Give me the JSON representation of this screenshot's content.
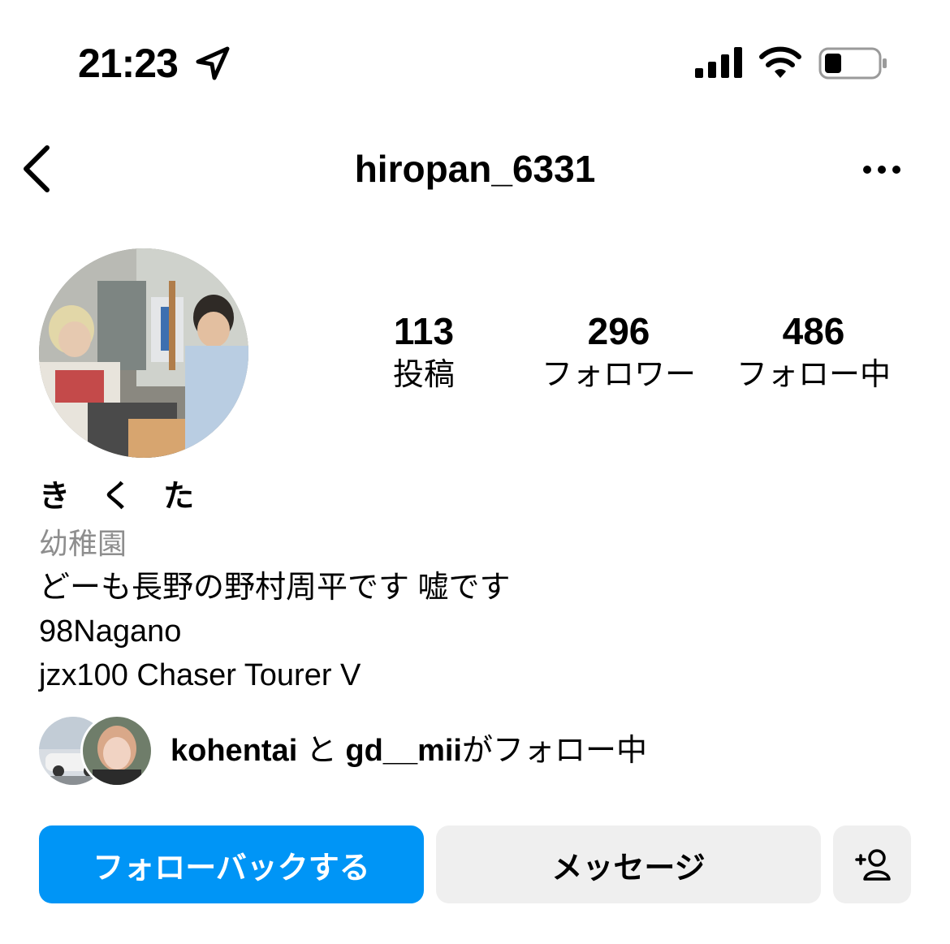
{
  "status_bar": {
    "time": "21:23",
    "icons": [
      "location-arrow-icon",
      "cellular-signal-icon",
      "wifi-icon",
      "battery-icon"
    ]
  },
  "header": {
    "username": "hiropan_6331",
    "back_icon": "chevron-left-icon",
    "more_icon": "ellipsis-icon"
  },
  "profile": {
    "stats": [
      {
        "value": "113",
        "label": "投稿"
      },
      {
        "value": "296",
        "label": "フォロワー"
      },
      {
        "value": "486",
        "label": "フォロー中"
      }
    ],
    "display_name": "き く た",
    "category": "幼稚園",
    "bio_lines": [
      "どーも長野の野村周平です 嘘です",
      "98Nagano",
      "jzx100 Chaser Tourer V"
    ]
  },
  "followed_by": {
    "user1": "kohentai",
    "connector": "と",
    "user2": "gd__mii",
    "suffix": "がフォロー中"
  },
  "actions": {
    "follow_back_label": "フォローバックする",
    "message_label": "メッセージ",
    "suggest_icon": "add-person-icon"
  },
  "colors": {
    "accent": "#0095f6",
    "secondary_button": "#efefef",
    "muted_text": "#8e8e8e"
  }
}
